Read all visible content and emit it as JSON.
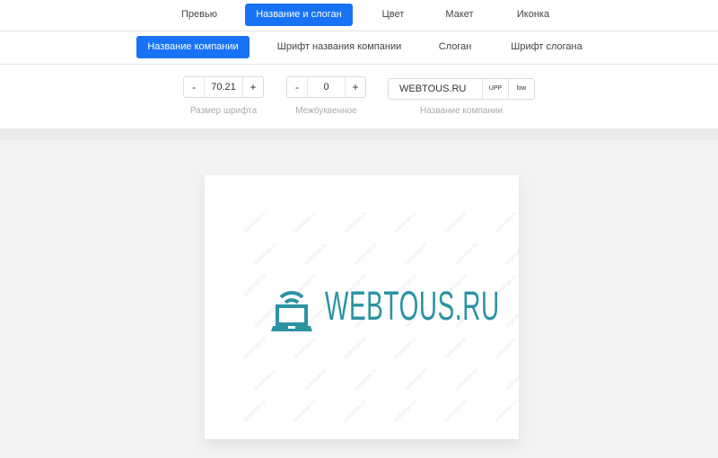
{
  "top_tabs": [
    {
      "label": "Превью"
    },
    {
      "label": "Название и слоган"
    },
    {
      "label": "Цвет"
    },
    {
      "label": "Макет"
    },
    {
      "label": "Иконка"
    }
  ],
  "sub_tabs": [
    {
      "label": "Название компании"
    },
    {
      "label": "Шрифт названия компании"
    },
    {
      "label": "Слоган"
    },
    {
      "label": "Шрифт слогана"
    }
  ],
  "controls": {
    "font_size": {
      "minus": "-",
      "value": "70.21",
      "plus": "+",
      "label": "Размер шрифта"
    },
    "letter_spacing": {
      "minus": "-",
      "value": "0",
      "plus": "+",
      "label": "Межбуквенное"
    },
    "company_name": {
      "value": "WEBTOUS.RU",
      "upper": "UPP",
      "lower": "low",
      "label": "Название компании"
    }
  },
  "preview": {
    "logo_text": "WEBTOUS.RU",
    "watermark": "turbologo.ru",
    "logo_color": "#2b93a2",
    "icon": "laptop-wifi-icon"
  },
  "colors": {
    "accent": "#1773f4"
  }
}
